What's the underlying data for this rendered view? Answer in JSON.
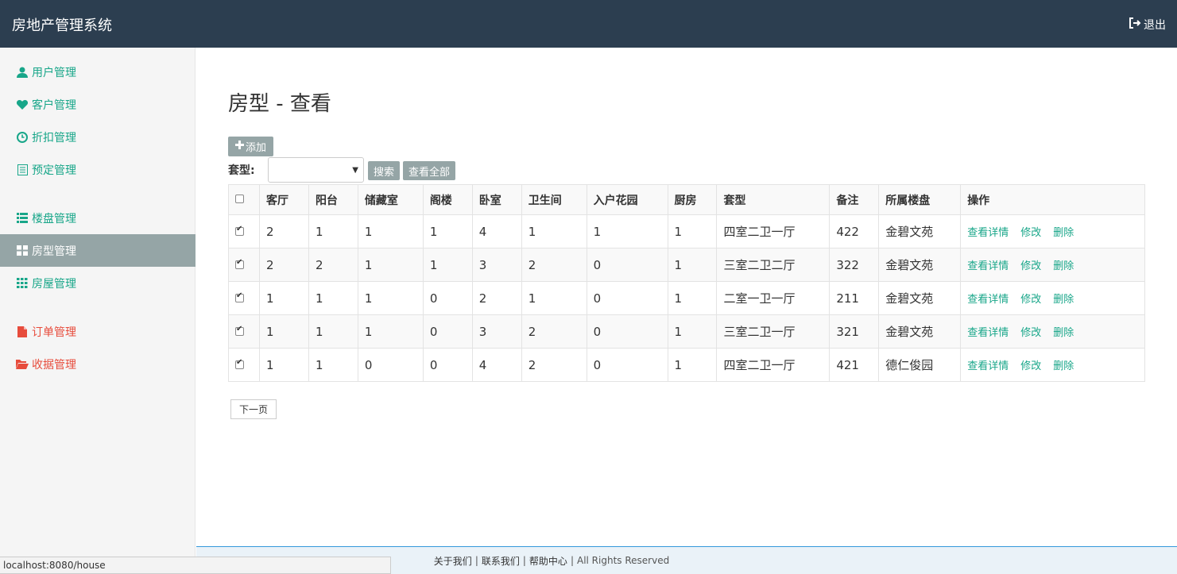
{
  "header": {
    "brand": "房地产管理系统",
    "logout_label": "退出"
  },
  "sidebar": {
    "items": [
      {
        "label": "用户管理",
        "icon": "user-icon"
      },
      {
        "label": "客户管理",
        "icon": "heart-icon"
      },
      {
        "label": "折扣管理",
        "icon": "clock-icon"
      },
      {
        "label": "预定管理",
        "icon": "list-icon"
      },
      {
        "label": "楼盘管理",
        "icon": "th-list-icon"
      },
      {
        "label": "房型管理",
        "icon": "th-large-icon"
      },
      {
        "label": "房屋管理",
        "icon": "th-icon"
      },
      {
        "label": "订单管理",
        "icon": "file-icon"
      },
      {
        "label": "收据管理",
        "icon": "folder-open-icon"
      }
    ]
  },
  "main": {
    "title": "房型 - 查看",
    "add_label": "添加",
    "filter_label": "套型:",
    "filter_value": "",
    "search_label": "搜索",
    "view_all_label": "查看全部",
    "next_page_label": "下一页"
  },
  "table": {
    "columns": [
      "客厅",
      "阳台",
      "储藏室",
      "阁楼",
      "卧室",
      "卫生间",
      "入户花园",
      "厨房",
      "套型",
      "备注",
      "所属楼盘",
      "操作"
    ],
    "rows": [
      [
        "2",
        "1",
        "1",
        "1",
        "4",
        "1",
        "1",
        "1",
        "四室二卫一厅",
        "422",
        "金碧文苑"
      ],
      [
        "2",
        "2",
        "1",
        "1",
        "3",
        "2",
        "0",
        "1",
        "三室二卫二厅",
        "322",
        "金碧文苑"
      ],
      [
        "1",
        "1",
        "1",
        "0",
        "2",
        "1",
        "0",
        "1",
        "二室一卫一厅",
        "211",
        "金碧文苑"
      ],
      [
        "1",
        "1",
        "1",
        "0",
        "3",
        "2",
        "0",
        "1",
        "三室二卫一厅",
        "321",
        "金碧文苑"
      ],
      [
        "1",
        "1",
        "0",
        "0",
        "4",
        "2",
        "0",
        "1",
        "四室二卫一厅",
        "421",
        "德仁俊园"
      ]
    ],
    "actions": {
      "detail": "查看详情",
      "edit": "修改",
      "delete": "删除"
    }
  },
  "footer": {
    "about": "关于我们",
    "contact": "联系我们",
    "help": "帮助中心",
    "rights": "All Rights Reserved"
  },
  "status_url": "localhost:8080/house",
  "colors": {
    "topbar": "#2c3e50",
    "accent": "#18a689",
    "active": "#95a5a6",
    "danger": "#e74c3c"
  }
}
